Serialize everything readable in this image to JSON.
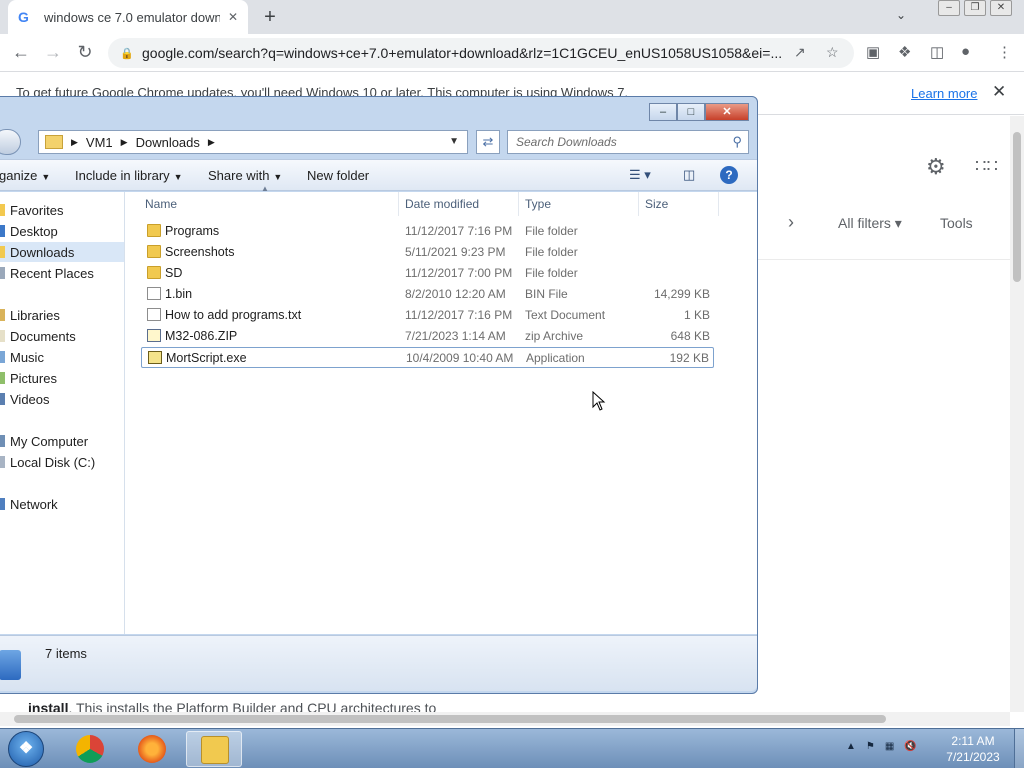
{
  "chrome": {
    "tab_title": "windows ce 7.0 emulator downlo",
    "tab_close": "✕",
    "newtab": "+",
    "url": "google.com/search?q=windows+ce+7.0+emulator+download&rlz=1C1GCEU_enUS1058US1058&ei=...",
    "info_text": "To get future Google Chrome updates, you'll need Windows 10 or later. This computer is using Windows 7.",
    "learn_more": "Learn more"
  },
  "google": {
    "all_filters": "All filters",
    "tools": "Tools",
    "snippet_bold": "install",
    "snippet_rest": ". This installs the Platform Builder and CPU architectures to"
  },
  "explorer": {
    "breadcrumbs": [
      "VM1",
      "Downloads"
    ],
    "search_placeholder": "Search Downloads",
    "toolbar": {
      "organize": "ganize",
      "include": "Include in library",
      "share": "Share with",
      "new_folder": "New folder"
    },
    "columns": {
      "name": "Name",
      "date": "Date modified",
      "type": "Type",
      "size": "Size"
    },
    "nav": {
      "favorites": "Favorites",
      "desktop": "Desktop",
      "downloads": "Downloads",
      "recent": "Recent Places",
      "libraries": "Libraries",
      "documents": "Documents",
      "music": "Music",
      "pictures": "Pictures",
      "videos": "Videos",
      "computer": "My Computer",
      "local_disk": "Local Disk (C:)",
      "network": "Network"
    },
    "files": [
      {
        "name": "Programs",
        "date": "11/12/2017 7:16 PM",
        "type": "File folder",
        "size": "",
        "icon": "folder-icon"
      },
      {
        "name": "Screenshots",
        "date": "5/11/2021 9:23 PM",
        "type": "File folder",
        "size": "",
        "icon": "folder-icon"
      },
      {
        "name": "SD",
        "date": "11/12/2017 7:00 PM",
        "type": "File folder",
        "size": "",
        "icon": "folder-icon"
      },
      {
        "name": "1.bin",
        "date": "8/2/2010 12:20 AM",
        "type": "BIN File",
        "size": "14,299 KB",
        "icon": "file-icon"
      },
      {
        "name": "How to add programs.txt",
        "date": "11/12/2017 7:16 PM",
        "type": "Text Document",
        "size": "1 KB",
        "icon": "text-file-icon"
      },
      {
        "name": "M32-086.ZIP",
        "date": "7/21/2023 1:14 AM",
        "type": "zip Archive",
        "size": "648 KB",
        "icon": "zip-icon"
      },
      {
        "name": "MortScript.exe",
        "date": "10/4/2009 10:40 AM",
        "type": "Application",
        "size": "192 KB",
        "icon": "exe-icon"
      }
    ],
    "status_count": "7 items"
  },
  "taskbar": {
    "time": "2:11 AM",
    "date": "7/21/2023"
  }
}
